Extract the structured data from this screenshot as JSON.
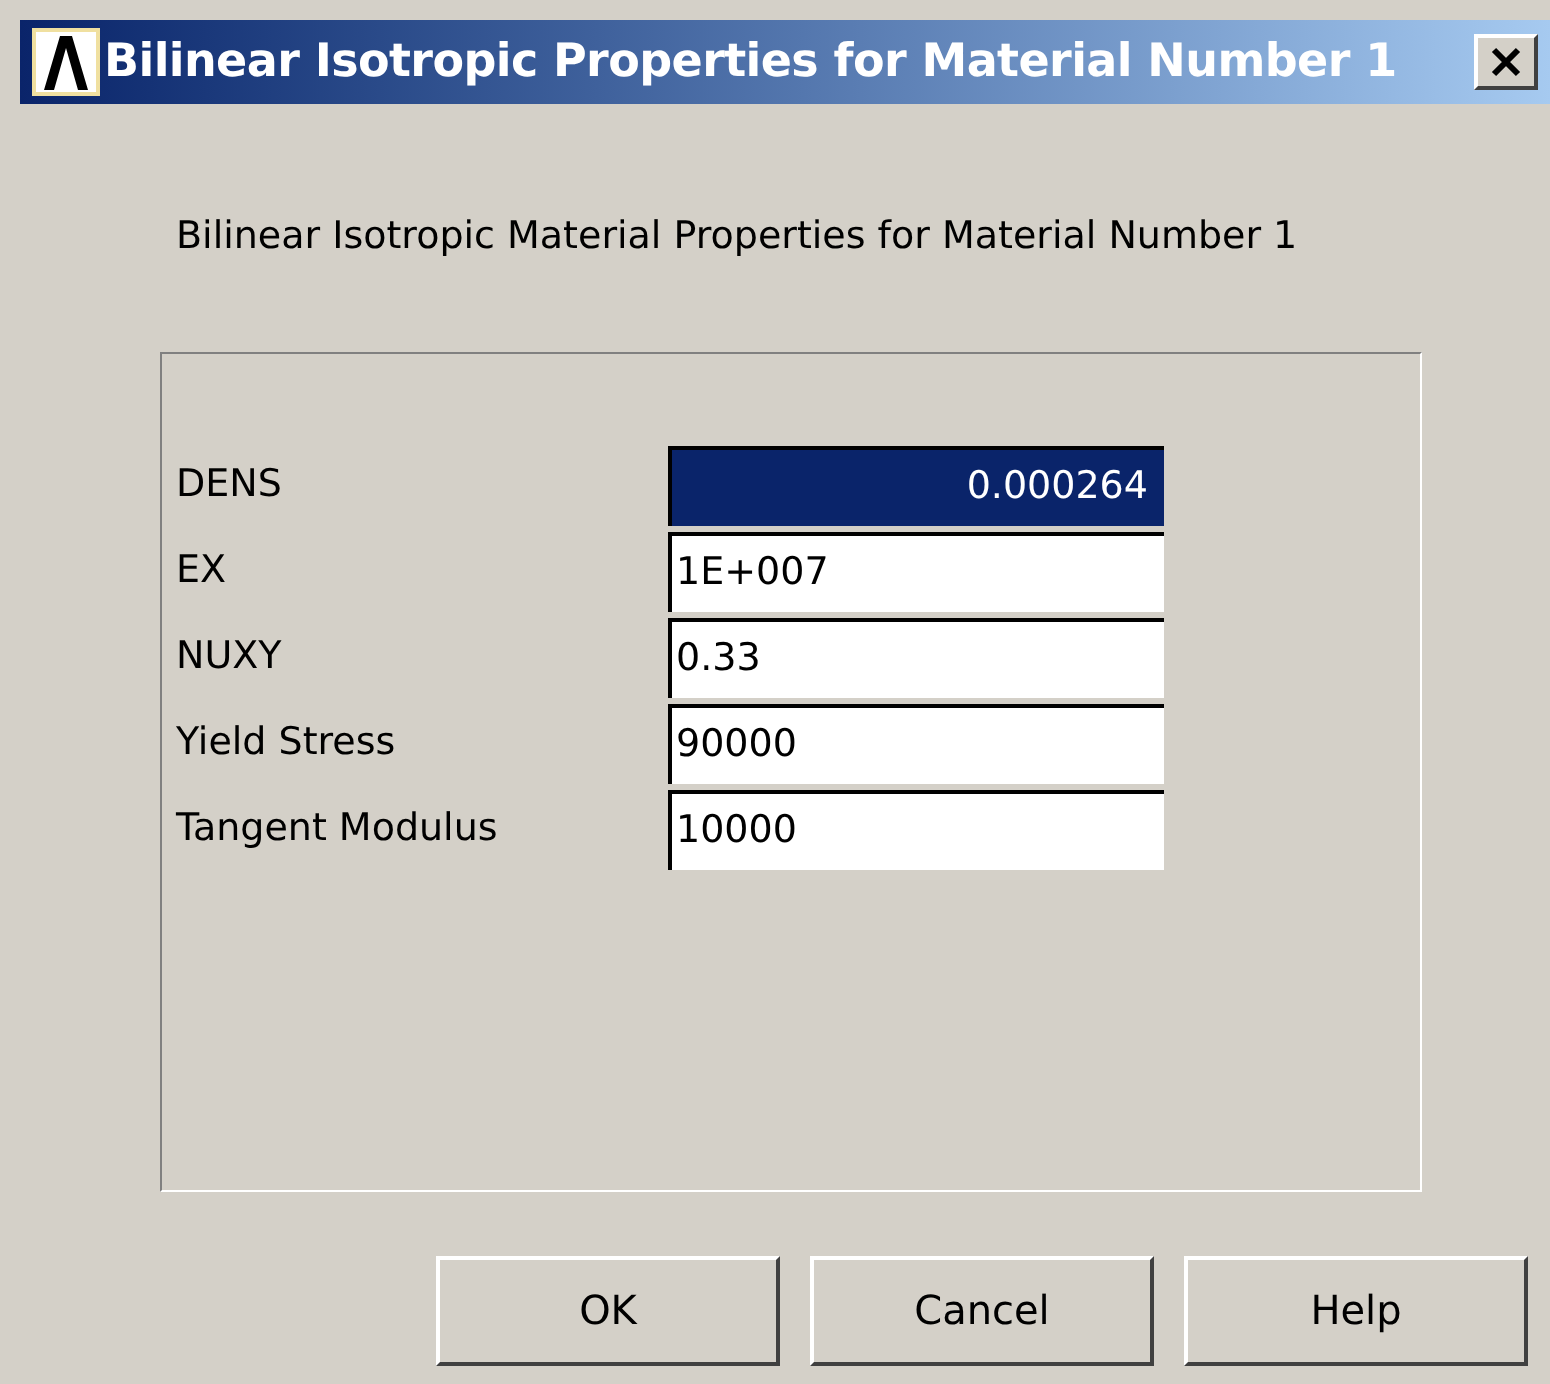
{
  "window": {
    "title": "Bilinear Isotropic Properties for Material Number 1"
  },
  "heading": "Bilinear Isotropic Material Properties for Material Number 1",
  "fields": [
    {
      "label": "DENS",
      "value": "0.000264",
      "selected": true
    },
    {
      "label": "EX",
      "value": "1E+007",
      "selected": false
    },
    {
      "label": "NUXY",
      "value": "0.33",
      "selected": false
    },
    {
      "label": "Yield Stress",
      "value": "90000",
      "selected": false
    },
    {
      "label": "Tangent Modulus",
      "value": "10000",
      "selected": false
    }
  ],
  "buttons": [
    "OK",
    "Cancel",
    "Help"
  ]
}
